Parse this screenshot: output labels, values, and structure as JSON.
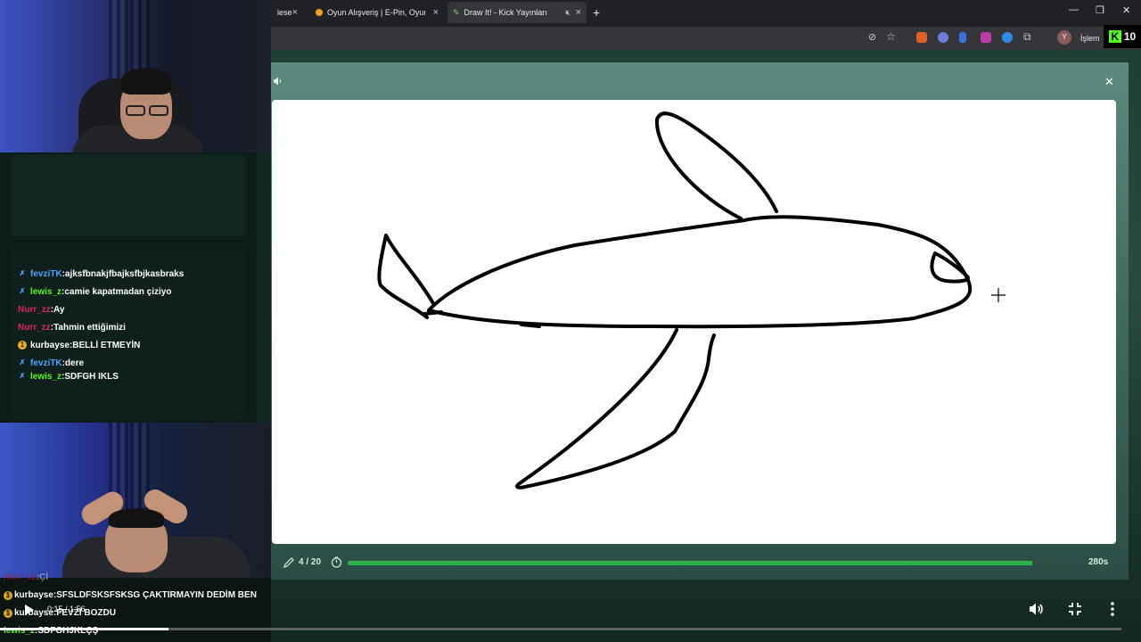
{
  "browser": {
    "tabs": [
      {
        "label": "lese",
        "active": false
      },
      {
        "label": "Oyun Alışveriş | E-Pin, Oyuncu",
        "active": false
      },
      {
        "label": "Draw It! - Kick Yayınları İçin",
        "active": true
      }
    ],
    "process_label": "İşlem",
    "kick_badge_number": "10",
    "profile_initial": "Y"
  },
  "chat": {
    "messages": [
      {
        "user": "fevziTK",
        "text": "ajksfbnakjfbajksfbjkasbraks",
        "user_color": "#4da3ff",
        "badge": "mod"
      },
      {
        "user": "lewis_z",
        "text": "camie kapatmadan çiziyo",
        "user_color": "#53fc18",
        "badge": "mod"
      },
      {
        "user": "Nurr_zz",
        "text": "Ay",
        "user_color": "#e0245e",
        "badge": "none"
      },
      {
        "user": "Nurr_zz",
        "text": "Tahmin ettiğimizi",
        "user_color": "#e0245e",
        "badge": "none"
      },
      {
        "user": "kurbayse",
        "text": "BELLİ ETMEYİN",
        "user_color": "#ffffff",
        "badge": "gift"
      },
      {
        "user": "fevziTK",
        "text": "dere",
        "user_color": "#4da3ff",
        "badge": "mod"
      },
      {
        "user": "lewis_z",
        "text": "SDFGH IKLS",
        "user_color": "#53fc18",
        "badge": "mod"
      }
    ]
  },
  "game": {
    "round": "4 / 20",
    "time_left": "280s",
    "timer_progress": 0.96
  },
  "overlay": {
    "lines": [
      {
        "user": "Nurr_zz",
        "text": "Çİ",
        "user_color": "#e0245e",
        "badge": "none"
      },
      {
        "user": "kurbayse",
        "text": "SFSLDFSKSFSKSG ÇAKTIRMAYIN DEDİM BEN",
        "user_color": "#ffffff",
        "badge": "gift"
      },
      {
        "user": "kurbayse",
        "text": "FEVZİ BOZDU",
        "user_color": "#ffffff",
        "badge": "gift"
      },
      {
        "user": "lewis_z",
        "text": "SDFGHJKLÇŞ",
        "user_color": "#53fc18",
        "badge": "none"
      }
    ],
    "video_time": "0:15 / 1:56",
    "video_progress": 0.15
  },
  "icons": {
    "sound": "sound-icon",
    "close": "close-icon",
    "pencil": "pencil-icon",
    "timer": "timer-icon",
    "play": "play-icon",
    "volume": "volume-icon",
    "fullscreen": "fullscreen-icon",
    "more": "more-icon"
  },
  "colors": {
    "progress_green": "#2bb34a",
    "kick_green": "#53fc18"
  }
}
